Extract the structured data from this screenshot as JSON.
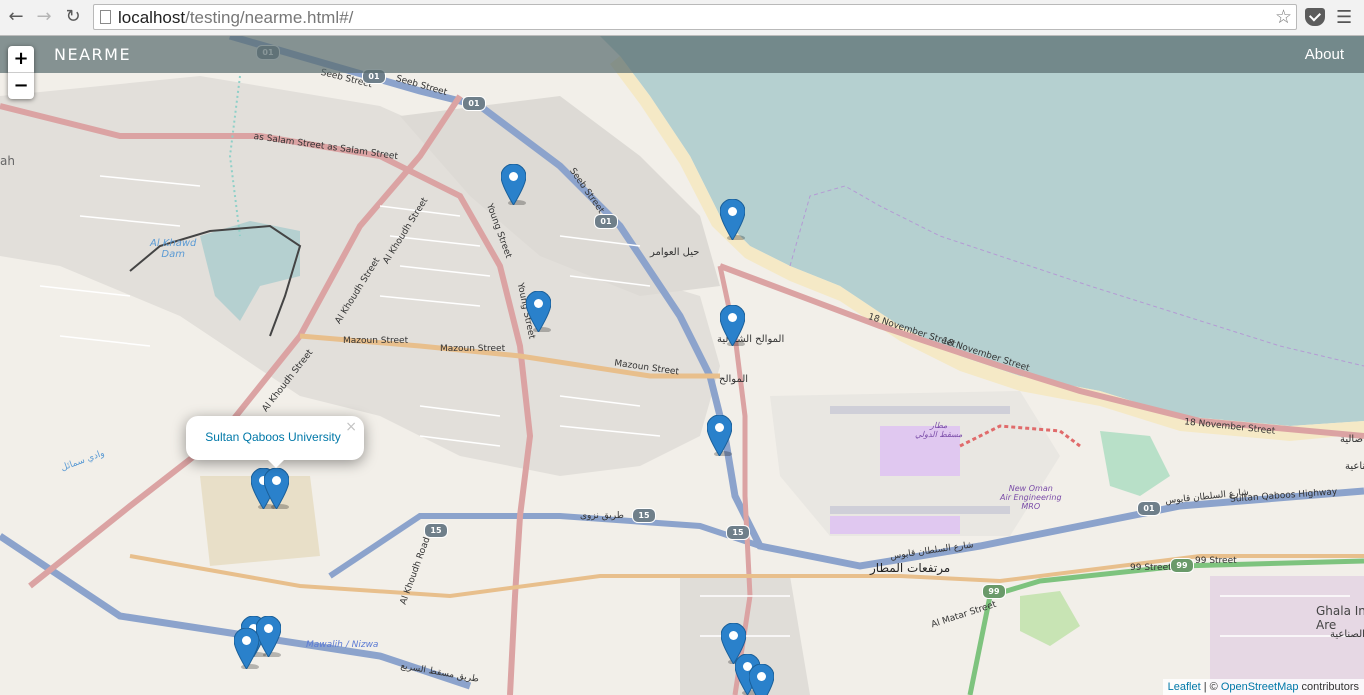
{
  "browser": {
    "back_icon": "back-arrow-icon",
    "forward_icon": "forward-arrow-icon",
    "reload_icon": "reload-icon",
    "url_host": "localhost",
    "url_path": "/testing/nearme.html#/",
    "star_icon": "bookmark-star-icon",
    "pocket_icon": "pocket-icon",
    "menu_icon": "hamburger-menu-icon"
  },
  "navbar": {
    "brand": "NEARME",
    "about": "About"
  },
  "zoom": {
    "in_label": "+",
    "out_label": "−"
  },
  "popup": {
    "text": "Sultan Qaboos University",
    "close": "×"
  },
  "attribution": {
    "leaflet": "Leaflet",
    "separator": " | © ",
    "osm": "OpenStreetMap",
    "contributors": " contributors"
  },
  "map_labels": {
    "seeb1": "Seeb Street",
    "seeb2": "Seeb Street",
    "salam": "as Salam Street as Salam Street",
    "khoudh1": "Al Khoudh Street",
    "khoudh2": "Al Khoudh Street",
    "khoudh3": "Al Khoudh Street",
    "young1": "Young Street",
    "young2": "Young Street",
    "seeb3": "Seeb Street",
    "mazoun1": "Mazoun Street",
    "mazoun2": "Mazoun Street",
    "mazoun3": "Mazoun Street",
    "nov1": "18 November Street",
    "nov2": "18 November Street",
    "nov3": "18 November Street",
    "khawd": "Al Khawd\nDam",
    "hayl": "حيل العوامر",
    "mawaleh_s": "الموالح الشمالية",
    "mawaleh": "الموالح",
    "matar": "مرتفعات المطار",
    "sq_hwy": "Sultan Qaboos Highway",
    "ar_sq": "شارع السلطان قابوس",
    "ar_sq2": "شارع السلطان قابوس",
    "nizwa_road": "طريق نزوى",
    "street99": "99 Street",
    "street99b": "99 Street",
    "matar_st": "Al Matar Street",
    "mawalih_nizwa": "Mawalih / Nizwa",
    "ar_nizwa": "طريق مسقط السريع",
    "ghala": "Ghala Ind\nAre",
    "ghala_ar": "الصناعية",
    "oman_air": "New Oman\nAir Engineering\nMRO",
    "airport_ar": "مطار\nمسقط الدولي",
    "ah": "ah",
    "wadi": "وادي سمائل",
    "right_ar1": "صالية",
    "right_ar2": "صناعية",
    "khoudh_road": "Al Khoudh Road"
  },
  "shields": {
    "r01a": "01",
    "r01b": "01",
    "r01c": "01",
    "r01d": "01",
    "r01e": "01",
    "r15a": "15",
    "r15b": "15",
    "r15c": "15",
    "r99a": "99",
    "r99b": "99"
  },
  "markers": {
    "count": 13,
    "icon": "map-marker-icon"
  }
}
